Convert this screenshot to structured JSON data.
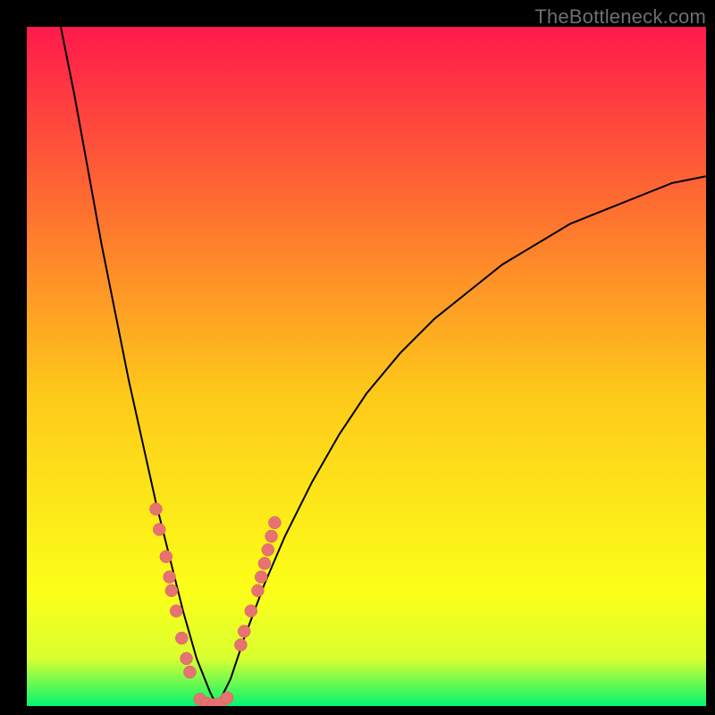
{
  "watermark": "TheBottleneck.com",
  "colors": {
    "gradient_top": "#fe1a4b",
    "gradient_q1": "#fe7030",
    "gradient_mid": "#fec91a",
    "gradient_q3": "#fcff18",
    "gradient_bottom_hi": "#d9ff30",
    "gradient_bottom_lo": "#03f56f",
    "frame": "#000000",
    "curve": "#000000",
    "dot_fill": "#e67272"
  },
  "chart_data": {
    "type": "line",
    "title": "",
    "xlabel": "",
    "ylabel": "",
    "xlim": [
      0,
      100
    ],
    "ylim": [
      0,
      100
    ],
    "note": "V-shaped mismatch/bottleneck curve; minimum reaches ~0 around x≈25–30. Left branch steep, right branch shallower.",
    "series": [
      {
        "name": "left_branch",
        "x": [
          5,
          7,
          9,
          11,
          13,
          15,
          17,
          19,
          21,
          23,
          25,
          27,
          28
        ],
        "y": [
          100,
          90,
          79,
          68,
          58,
          48,
          39,
          30,
          22,
          14,
          7,
          2,
          0
        ]
      },
      {
        "name": "right_branch",
        "x": [
          28,
          30,
          32,
          35,
          38,
          42,
          46,
          50,
          55,
          60,
          65,
          70,
          75,
          80,
          85,
          90,
          95,
          100
        ],
        "y": [
          0,
          4,
          10,
          18,
          25,
          33,
          40,
          46,
          52,
          57,
          61,
          65,
          68,
          71,
          73,
          75,
          77,
          78
        ]
      }
    ],
    "scatter_overlay": {
      "name": "highlighted_points",
      "left_cluster": {
        "x": [
          19.0,
          19.5,
          20.5,
          21.0,
          21.3,
          22.0,
          22.8,
          23.5,
          24.0
        ],
        "y": [
          29,
          26,
          22,
          19,
          17,
          14,
          10,
          7,
          5
        ]
      },
      "bottom_cluster": {
        "x": [
          25.5,
          26.5,
          27.5,
          28.5,
          29.5
        ],
        "y": [
          1.0,
          0.4,
          0.2,
          0.4,
          1.2
        ]
      },
      "right_cluster": {
        "x": [
          31.5,
          32.0,
          33.0,
          34.0,
          34.5,
          35.0,
          35.5,
          36.0,
          36.5
        ],
        "y": [
          9,
          11,
          14,
          17,
          19,
          21,
          23,
          25,
          27
        ]
      }
    }
  }
}
